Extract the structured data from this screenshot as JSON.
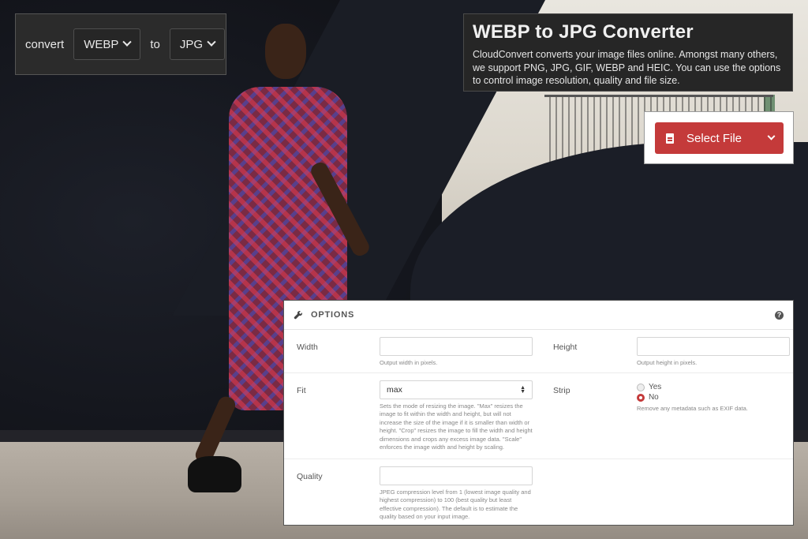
{
  "converter": {
    "convert_label": "convert",
    "from_format": "WEBP",
    "to_label": "to",
    "to_format": "JPG"
  },
  "header": {
    "title": "WEBP to JPG Converter",
    "description": "CloudConvert converts your image files online. Amongst many others, we support PNG, JPG, GIF, WEBP and HEIC. You can use the options to control image resolution, quality and file size."
  },
  "select_file": {
    "label": "Select File",
    "icon": "file-icon"
  },
  "options": {
    "title": "OPTIONS",
    "width": {
      "label": "Width",
      "value": "",
      "help": "Output width in pixels."
    },
    "height": {
      "label": "Height",
      "value": "",
      "help": "Output height in pixels."
    },
    "fit": {
      "label": "Fit",
      "value": "max",
      "help": "Sets the mode of resizing the image. \"Max\" resizes the image to fit within the width and height, but will not increase the size of the image if it is smaller than width or height. \"Crop\" resizes the image to fill the width and height dimensions and crops any excess image data. \"Scale\" enforces the image width and height by scaling."
    },
    "strip": {
      "label": "Strip",
      "options": [
        "Yes",
        "No"
      ],
      "selected": "No",
      "help": "Remove any metadata such as EXIF data."
    },
    "quality": {
      "label": "Quality",
      "value": "",
      "help": "JPEG compression level from 1 (lowest image quality and highest compression) to 100 (best quality but least effective compression). The default is to estimate the quality based on your input image."
    }
  },
  "colors": {
    "accent": "#c43a3a",
    "dark_panel": "#262626"
  }
}
